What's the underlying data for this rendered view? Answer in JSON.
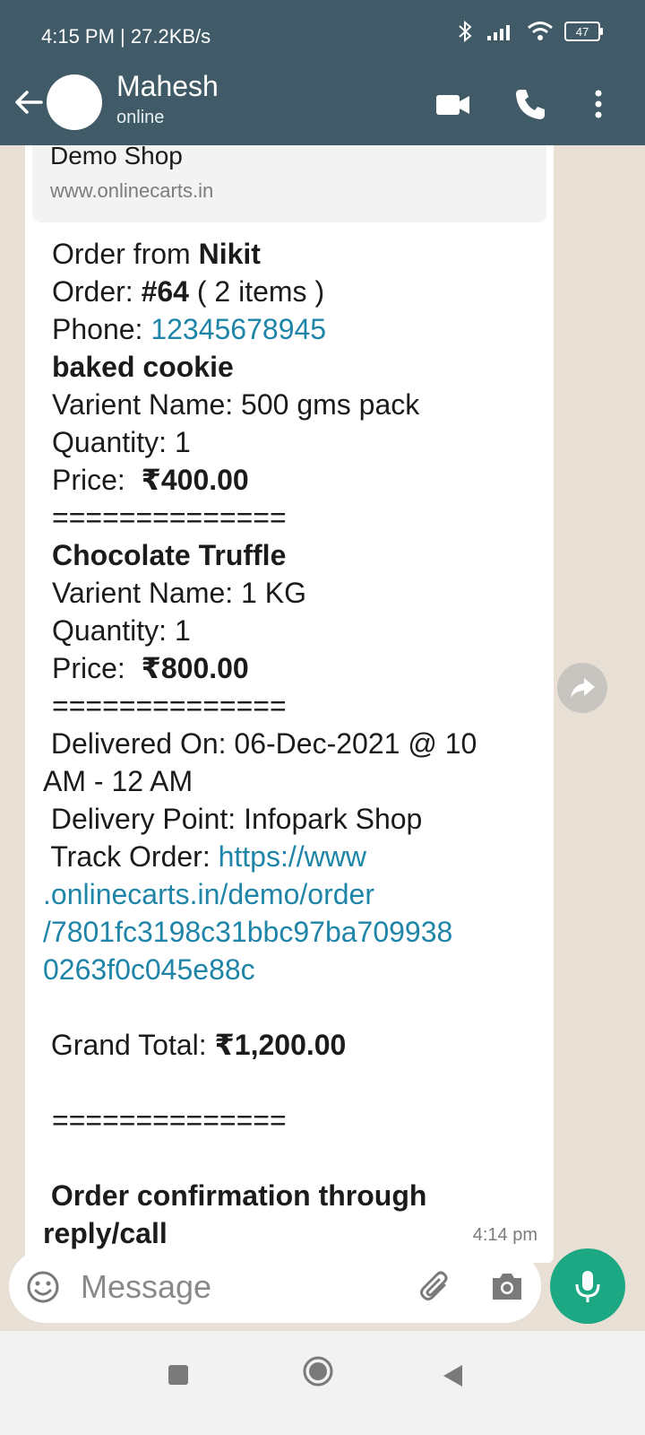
{
  "status_bar": {
    "time": "4:15 PM | 27.2KB/s",
    "battery": "47",
    "icons": [
      "bluetooth-icon",
      "signal-icon",
      "wifi-icon",
      "battery-icon"
    ]
  },
  "header": {
    "contact_name": "Mahesh",
    "contact_status": "online",
    "icons": [
      "back-arrow-icon",
      "video-call-icon",
      "phone-call-icon",
      "more-options-icon"
    ]
  },
  "link_preview": {
    "title": "Demo Shop",
    "url": "www.onlinecarts.in"
  },
  "message": {
    "order_prefix": "Order from ",
    "customer": "Nikit",
    "order_label": "Order: ",
    "order_no": "#64",
    "order_items": " ( 2 items )",
    "phone_label": "Phone: ",
    "phone": "12345678945",
    "item1_name": "baked cookie",
    "item1_variant": "Varient Name: 500 gms pack",
    "item1_qty": "Quantity: 1",
    "item1_price_label": "Price:  ",
    "item1_price": "₹400.00",
    "separator": "==============",
    "item2_name": "Chocolate Truffle",
    "item2_variant": "Varient Name: 1 KG",
    "item2_qty": "Quantity: 1",
    "item2_price_label": "Price:  ",
    "item2_price": "₹800.00",
    "delivered_line1": " Delivered On: 06-Dec-2021 @ 10",
    "delivered_line2": "AM - 12 AM",
    "delivery_point": " Delivery Point: Infopark Shop",
    "track_label": " Track Order: ",
    "track_link_1": "https://www",
    "track_link_2": ".onlinecarts.in/demo/order",
    "track_link_3": "/7801fc3198c31bbc97ba709938",
    "track_link_4": "0263f0c045e88c",
    "grand_total_label": " Grand Total: ",
    "grand_total": "₹1,200.00",
    "confirm_line1": " Order confirmation through",
    "confirm_line2": "reply/call",
    "time": "4:14 pm"
  },
  "input_bar": {
    "placeholder": "Message",
    "icons": [
      "emoji-icon",
      "attach-icon",
      "camera-icon",
      "mic-icon"
    ]
  },
  "nav_bar": {
    "icons": [
      "recent-apps-icon",
      "home-icon",
      "back-icon"
    ]
  }
}
